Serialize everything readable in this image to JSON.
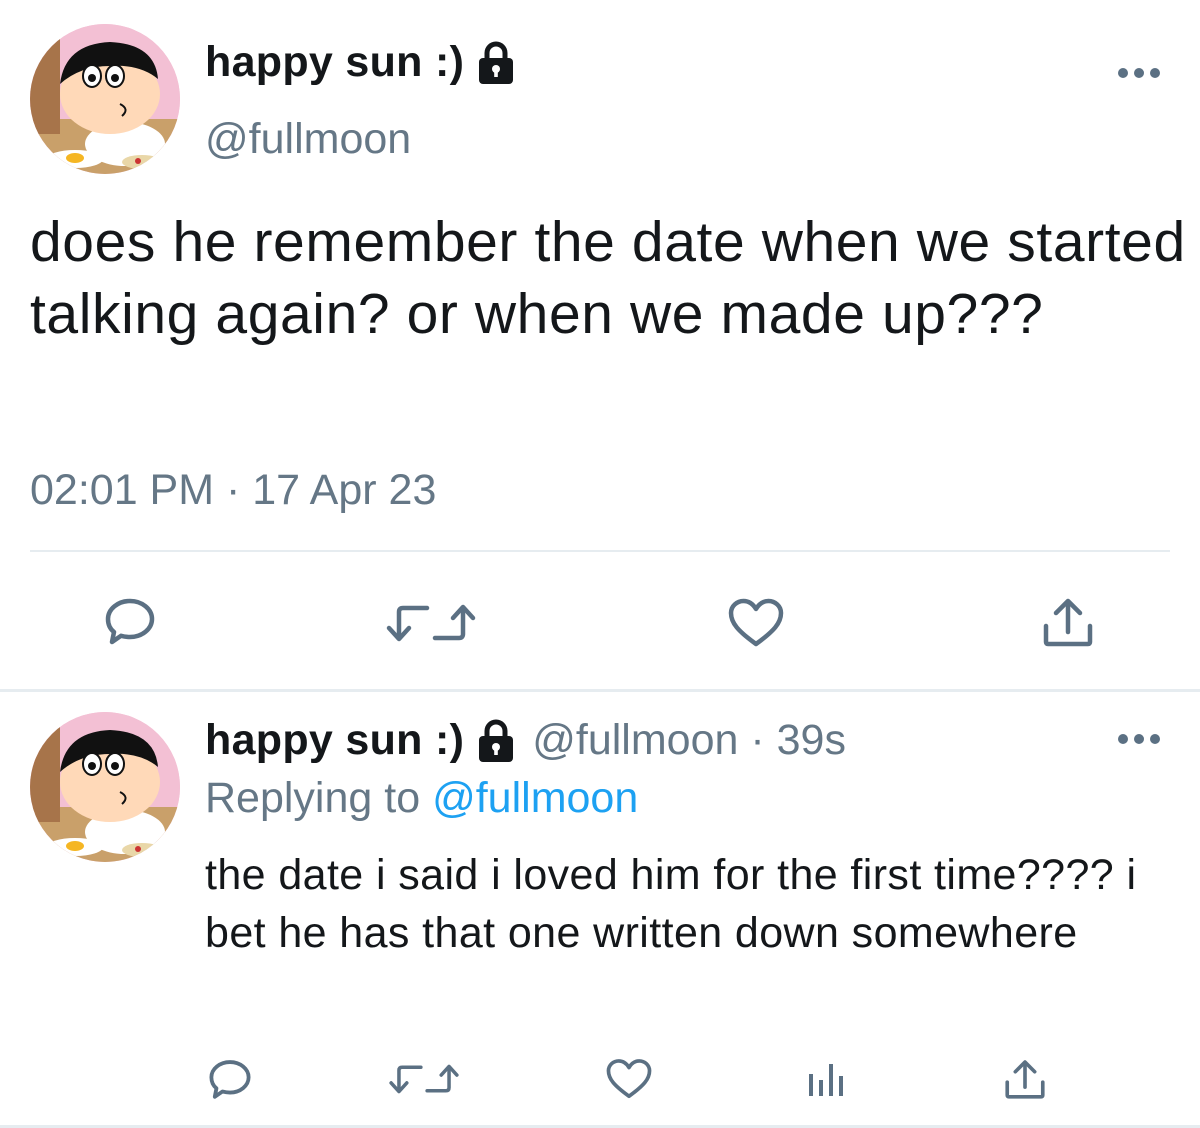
{
  "main_tweet": {
    "display_name": "happy sun :)",
    "handle": "@fullmoon",
    "text": "does he remember the date when we started talking again? or when we made up???",
    "timestamp": "02:01 PM · 17 Apr 23",
    "icons": [
      "lock-icon",
      "more-icon",
      "reply-icon",
      "retweet-icon",
      "like-icon",
      "share-icon"
    ]
  },
  "reply_tweet": {
    "display_name": "happy sun :)",
    "handle_time": "@fullmoon · 39s",
    "replying_prefix": "Replying to ",
    "replying_to": "@fullmoon",
    "text": "the date i said i loved him for the first time???? i bet he has that one written down somewhere",
    "icons": [
      "lock-icon",
      "more-icon",
      "reply-icon",
      "retweet-icon",
      "like-icon",
      "analytics-icon",
      "share-icon"
    ]
  },
  "colors": {
    "text_primary": "#14171a",
    "text_secondary": "#657786",
    "link": "#1da1f2",
    "icon": "#5b7083",
    "divider": "#e6ecf0"
  }
}
